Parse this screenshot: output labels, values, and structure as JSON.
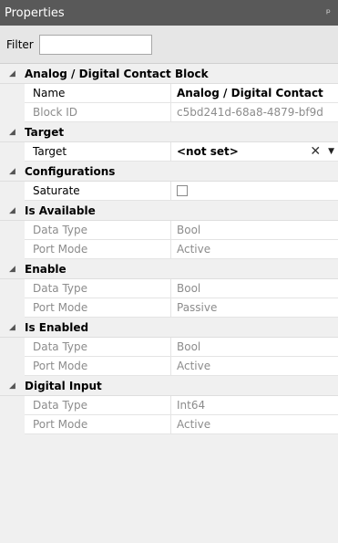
{
  "panel": {
    "title": "Properties",
    "pin_glyph": "ᵖ"
  },
  "filter": {
    "label": "Filter",
    "value": "",
    "placeholder": ""
  },
  "categories": {
    "block": {
      "title": "Analog / Digital Contact Block",
      "name_label": "Name",
      "name_value": "Analog / Digital Contact",
      "blockid_label": "Block ID",
      "blockid_value": "c5bd241d-68a8-4879-bf9d"
    },
    "target": {
      "title": "Target",
      "label": "Target",
      "value": "<not set>",
      "clear_glyph": "✕",
      "dropdown_glyph": "▼"
    },
    "configurations": {
      "title": "Configurations",
      "saturate_label": "Saturate",
      "saturate_checked": false
    },
    "is_available": {
      "title": "Is Available",
      "datatype_label": "Data Type",
      "datatype_value": "Bool",
      "portmode_label": "Port Mode",
      "portmode_value": "Active"
    },
    "enable": {
      "title": "Enable",
      "datatype_label": "Data Type",
      "datatype_value": "Bool",
      "portmode_label": "Port Mode",
      "portmode_value": "Passive"
    },
    "is_enabled": {
      "title": "Is Enabled",
      "datatype_label": "Data Type",
      "datatype_value": "Bool",
      "portmode_label": "Port Mode",
      "portmode_value": "Active"
    },
    "digital_input": {
      "title": "Digital Input",
      "datatype_label": "Data Type",
      "datatype_value": "Int64",
      "portmode_label": "Port Mode",
      "portmode_value": "Active"
    }
  },
  "icons": {
    "collapse": "expanded-triangle-icon",
    "pin": "pin-icon",
    "clear": "clear-x-icon",
    "dropdown": "dropdown-arrow-icon"
  }
}
